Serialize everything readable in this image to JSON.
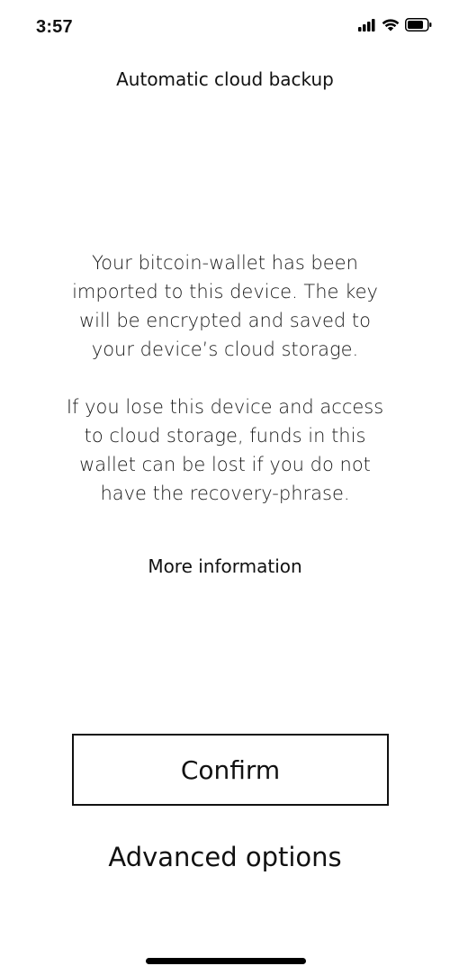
{
  "status_bar": {
    "time": "3:57",
    "icons": [
      "cellular-signal-icon",
      "wifi-icon",
      "battery-icon"
    ]
  },
  "screen": {
    "title": "Automatic cloud backup",
    "paragraph_1": "Your bitcoin-wallet has been imported to this device. The key will be encrypted and saved to your device’s cloud storage.",
    "paragraph_2": "If you lose this device and access to cloud storage, funds in this wallet can be lost if you do not have the recovery-phrase.",
    "more_info_label": "More information",
    "confirm_label": "Confirm",
    "advanced_label": "Advanced options"
  },
  "colors": {
    "background": "#ffffff",
    "text": "#111111"
  }
}
